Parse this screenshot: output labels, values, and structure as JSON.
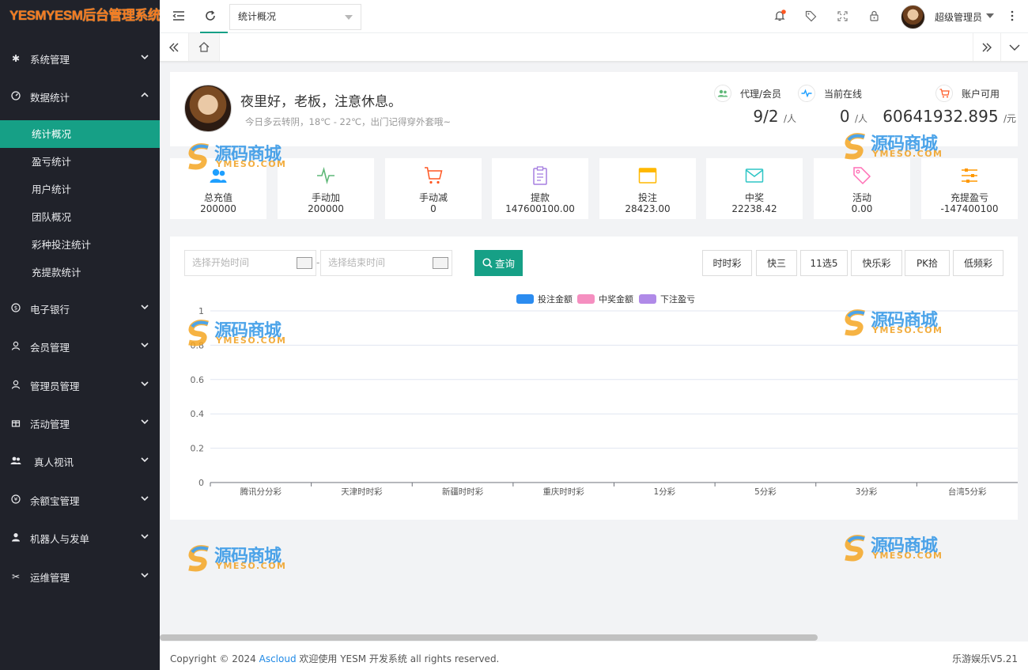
{
  "app": {
    "logo_text": "YESMYESM后台管理系统"
  },
  "sidebar": {
    "items": [
      {
        "label": "系统管理",
        "icon": "gear-icon"
      },
      {
        "label": "数据统计",
        "icon": "dashboard-icon"
      },
      {
        "label": "电子银行",
        "icon": "dollar-icon"
      },
      {
        "label": "会员管理",
        "icon": "member-icon"
      },
      {
        "label": "管理员管理",
        "icon": "user-icon"
      },
      {
        "label": "活动管理",
        "icon": "gift-icon"
      },
      {
        "label": "真人视讯",
        "icon": "users-icon"
      },
      {
        "label": "余额宝管理",
        "icon": "yen-icon"
      },
      {
        "label": "机器人与发单",
        "icon": "person-icon"
      },
      {
        "label": "运维管理",
        "icon": "tools-icon"
      }
    ],
    "sub_items": [
      {
        "label": "统计概况",
        "active": true
      },
      {
        "label": "盈亏统计"
      },
      {
        "label": "用户统计"
      },
      {
        "label": "团队概况"
      },
      {
        "label": "彩种投注统计"
      },
      {
        "label": "充提款统计"
      }
    ]
  },
  "topbar": {
    "page_select": "统计概况",
    "user_name": "超级管理员",
    "notification_dot_color": "#ff5722"
  },
  "welcome": {
    "greeting": "夜里好，老板，注意休息。",
    "weather": "今日多云转阴，18℃ - 22℃，出门记得穿外套哦~",
    "stats": [
      {
        "label": "代理/会员",
        "value": "9/2",
        "unit": "/人",
        "icon": "members-icon",
        "color": "#5fb878"
      },
      {
        "label": "当前在线",
        "value": "0",
        "unit": "/人",
        "icon": "pulse-icon",
        "color": "#1e9fff"
      },
      {
        "label": "账户可用",
        "value": "60641932.895",
        "unit": "/元",
        "icon": "cart-icon",
        "color": "#ff5722"
      }
    ]
  },
  "kpis": [
    {
      "label": "总充值",
      "value": "200000",
      "icon": "users-icon",
      "color": "#1e9fff"
    },
    {
      "label": "手动加",
      "value": "200000",
      "icon": "pulse-icon",
      "color": "#5fb878"
    },
    {
      "label": "手动减",
      "value": "0",
      "icon": "cart-icon",
      "color": "#ff5722"
    },
    {
      "label": "提款",
      "value": "147600100.00",
      "icon": "clipboard-icon",
      "color": "#a57ee0"
    },
    {
      "label": "投注",
      "value": "28423.00",
      "icon": "window-icon",
      "color": "#ffb800"
    },
    {
      "label": "中奖",
      "value": "22238.42",
      "icon": "mail-icon",
      "color": "#2fc6c6"
    },
    {
      "label": "活动",
      "value": "0.00",
      "icon": "tag-icon",
      "color": "#ff6fb5"
    },
    {
      "label": "充提盈亏",
      "value": "-147400100",
      "icon": "sliders-icon",
      "color": "#ff9800"
    }
  ],
  "filters": {
    "start_placeholder": "选择开始时间",
    "end_placeholder": "选择结束时间",
    "separator": "-",
    "query_label": "查询",
    "lottery_types": [
      "时时彩",
      "快三",
      "11选5",
      "快乐彩",
      "PK拾",
      "低频彩"
    ]
  },
  "chart_data": {
    "type": "bar",
    "categories": [
      "腾讯分分彩",
      "天津时时彩",
      "新疆时时彩",
      "重庆时时彩",
      "1分彩",
      "5分彩",
      "3分彩",
      "台湾5分彩"
    ],
    "series": [
      {
        "name": "投注金额",
        "color": "#2b8cf0",
        "values": [
          0,
          0,
          0,
          0,
          0,
          0,
          0,
          0
        ]
      },
      {
        "name": "中奖金额",
        "color": "#f58fc0",
        "values": [
          0,
          0,
          0,
          0,
          0,
          0,
          0,
          0
        ]
      },
      {
        "name": "下注盈亏",
        "color": "#b08ae8",
        "values": [
          0,
          0,
          0,
          0,
          0,
          0,
          0,
          0
        ]
      }
    ],
    "yticks": [
      "0",
      "0.2",
      "0.4",
      "0.6",
      "0.8",
      "1"
    ],
    "ylim": [
      0,
      1
    ],
    "grid": true,
    "legend": "top-center"
  },
  "watermark": {
    "text": "源码商城",
    "sub": "YMESO.COM"
  },
  "footer": {
    "copyright_prefix": "Copyright © 2024 ",
    "link": "Ascloud",
    "copyright_suffix": " 欢迎使用 YESM 开发系统 all rights reserved.",
    "version": "乐游娱乐V5.21"
  }
}
